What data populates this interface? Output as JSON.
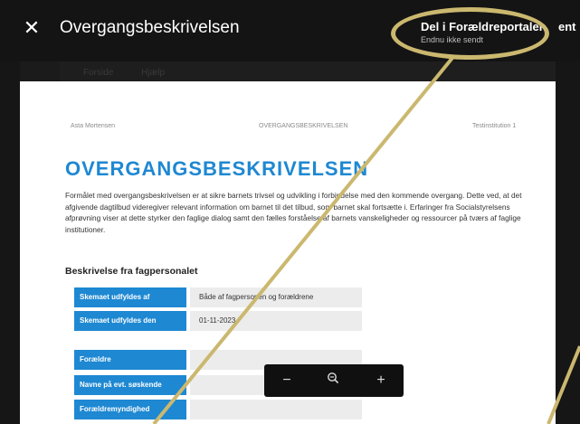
{
  "window": {
    "title": "Overgangsbeskrivelsen",
    "close_icon": "close-icon"
  },
  "share": {
    "label": "Del i Forældreportalen",
    "status": "Endnu ikke sendt",
    "next_label": "ent"
  },
  "tabs": [
    "Forside",
    "Hjælp"
  ],
  "document": {
    "author": "Asta Mortensen",
    "header_title": "OVERGANGSBESKRIVELSEN",
    "institution": "Testinstitution 1",
    "heading": "OVERGANGSBESKRIVELSEN",
    "intro": "Formålet med overgangsbeskrivelsen er at sikre barnets trivsel og udvikling i forbindelse med den kommende overgang. Dette ved, at det afgivende dagtilbud videregiver relevant information om barnet til det tilbud, som barnet skal fortsætte i. Erfaringer fra Socialstyrelsens afprøvning viser at dette styrker den faglige dialog samt den fælles forståelse af barnets vanskeligheder og ressourcer på tværs af faglige institutioner.",
    "section_title": "Beskrivelse fra fagpersonalet",
    "fields": [
      {
        "label": "Skemaet udfyldes af",
        "value": "Både af fagpersonen og forældrene"
      },
      {
        "label": "Skemaet udfyldes den",
        "value": "01-11-2023"
      },
      {
        "label": "Forældre",
        "value": ""
      },
      {
        "label": "Navne på evt. søskende",
        "value": ""
      },
      {
        "label": "Forældremyndighed",
        "value": ""
      }
    ]
  },
  "zoom": {
    "out_icon": "minus-icon",
    "reset_icon": "magnifier-icon",
    "in_icon": "plus-icon"
  },
  "colors": {
    "accent": "#1e88d2",
    "annotation": "#cbb86f",
    "topbar": "#141414"
  }
}
